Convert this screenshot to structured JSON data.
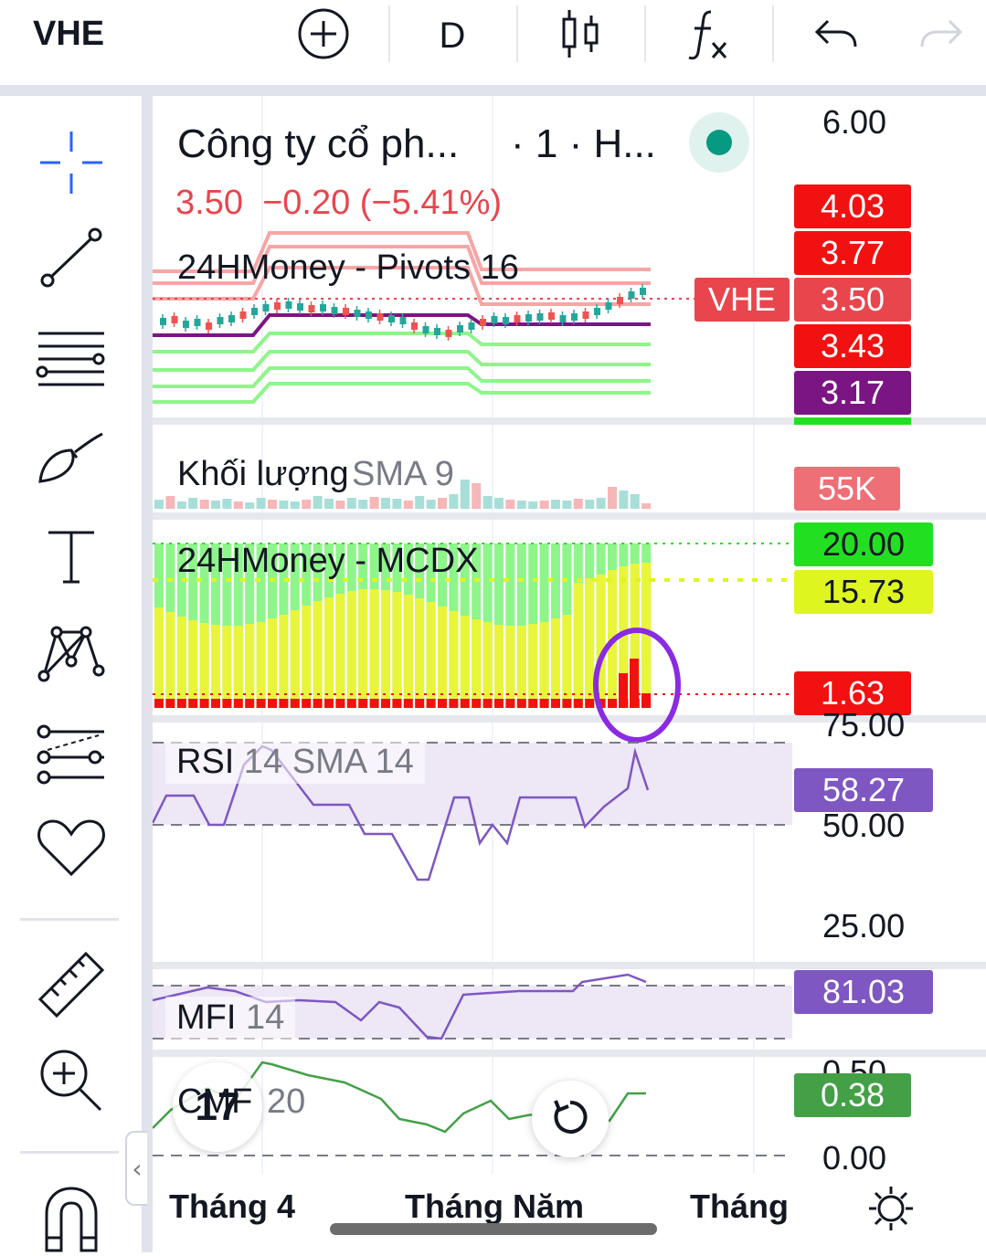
{
  "header": {
    "symbol": "VHE",
    "interval": "D",
    "icons": [
      "add-circle-icon",
      "candles-icon",
      "indicators-fx-icon",
      "undo-icon",
      "redo-icon"
    ]
  },
  "toolbar": {
    "icons": [
      "crosshair-icon",
      "trend-line-icon",
      "fib-lines-icon",
      "brush-icon",
      "text-icon",
      "pattern-icon",
      "forecast-icon",
      "favorites-heart-icon",
      "ruler-icon",
      "zoom-in-icon",
      "magnet-icon"
    ],
    "collapse_glyph": "‹"
  },
  "main_pane": {
    "title": "Công ty cổ ph...",
    "title_suffix": "· 1 · H...",
    "price_change": "3.50  −0.20 (−5.41%)",
    "pivots_label": "24HMoney - Pivots 16",
    "scale_top": "6.00",
    "price_tags": [
      {
        "text": "4.03",
        "color": "#f21111"
      },
      {
        "text": "3.77",
        "color": "#f21111"
      },
      {
        "text": "3.50",
        "color": "#e8454d"
      },
      {
        "text": "3.43",
        "color": "#f21111"
      },
      {
        "text": "3.17",
        "color": "#7b1583"
      }
    ],
    "symbol_tag": "VHE",
    "status_color": "#089981"
  },
  "volume_pane": {
    "label": "Khối lượng",
    "sma_label": "SMA 9",
    "tag": "55K"
  },
  "mcdx_pane": {
    "label": "24HMoney - MCDX",
    "tags": [
      {
        "text": "20.00",
        "color": "#22e021"
      },
      {
        "text": "15.73",
        "color": "#dff51f"
      },
      {
        "text": "1.63",
        "color": "#f21111"
      }
    ]
  },
  "rsi_pane": {
    "label": "RSI",
    "params": "14 SMA 14",
    "tag": "58.27",
    "scale": [
      "75.00",
      "50.00",
      "25.00"
    ]
  },
  "mfi_pane": {
    "label": "MFI",
    "params": "14",
    "tag": "81.03"
  },
  "cmf_pane": {
    "label": "CMF",
    "params": "20",
    "tag": "0.38",
    "scale": [
      "0.50",
      "0.00"
    ]
  },
  "time_axis": [
    "Tháng 4",
    "Tháng Năm",
    "Tháng"
  ],
  "bottom": {
    "settings_icon": "settings-sun-icon",
    "reset_icon": "reset-rotate-icon",
    "logo_text": "17"
  }
}
